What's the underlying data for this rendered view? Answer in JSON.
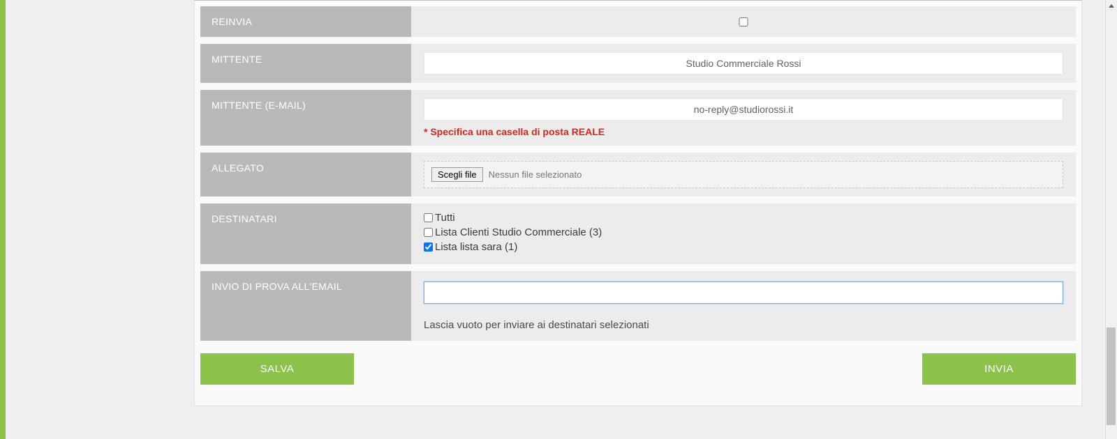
{
  "form": {
    "reinvia": {
      "label": "REINVIA",
      "checked": false
    },
    "mittente": {
      "label": "MITTENTE",
      "value": "Studio Commerciale Rossi"
    },
    "mittente_email": {
      "label": "MITTENTE (E-MAIL)",
      "value": "no-reply@studiorossi.it",
      "hint": "* Specifica una casella di posta REALE"
    },
    "allegato": {
      "label": "ALLEGATO",
      "button": "Scegli file",
      "status": "Nessun file selezionato"
    },
    "destinatari": {
      "label": "DESTINATARI",
      "options": [
        {
          "label": "Tutti",
          "checked": false
        },
        {
          "label": "Lista Clienti Studio Commerciale (3)",
          "checked": false
        },
        {
          "label": "Lista lista sara (1)",
          "checked": true
        }
      ]
    },
    "invio_prova": {
      "label": "INVIO DI PROVA ALL'EMAIL",
      "value": "",
      "hint": "Lascia vuoto per inviare ai destinatari selezionati"
    }
  },
  "buttons": {
    "save": "SALVA",
    "send": "INVIA"
  }
}
